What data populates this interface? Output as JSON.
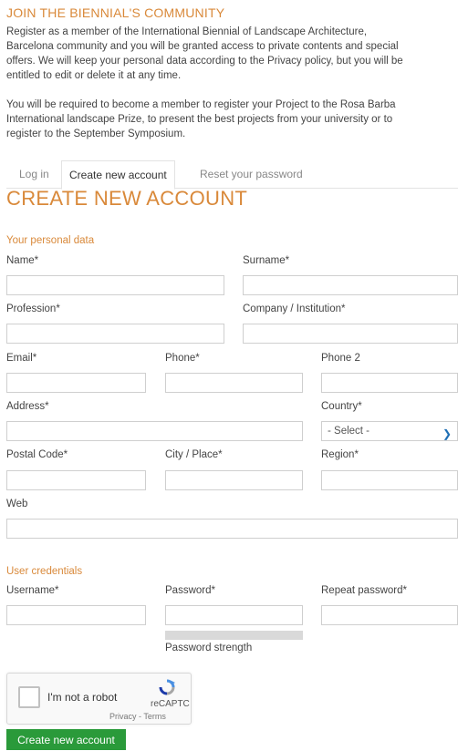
{
  "header": {
    "title": "JOIN THE BIENNIAL'S COMMUNITY",
    "para1": [
      "Register as a member of the International Biennial of Landscape Architecture,",
      "Barcelona community and you will be granted access to private contents and special",
      "offers. We will keep your personal data according to the Privacy policy, but you will be",
      "entitled to edit or delete it at any time."
    ],
    "para2": [
      "You will be required to become a member to register your Project to the Rosa Barba",
      "International landscape Prize, to present the best projects from your university or to",
      "register to the September Symposium."
    ]
  },
  "tabs": [
    {
      "label": "Log in",
      "active": false
    },
    {
      "label": "Create new account",
      "active": true
    },
    {
      "label": "Reset your password",
      "active": false
    }
  ],
  "form": {
    "title": "CREATE NEW ACCOUNT",
    "personal_section": "Your personal data",
    "labels": {
      "name": "Name*",
      "surname": "Surname*",
      "profession": "Profession*",
      "company": "Company / Institution*",
      "email": "Email*",
      "phone": "Phone*",
      "phone2": "Phone 2",
      "address": "Address*",
      "country": "Country*",
      "postal": "Postal Code*",
      "city": "City / Place*",
      "region": "Region*",
      "web": "Web"
    },
    "country_select": "- Select -",
    "credentials_section": "User credentials",
    "cred_labels": {
      "username": "Username*",
      "password": "Password*",
      "repeat": "Repeat password*"
    },
    "strength_label": "Password strength",
    "submit": "Create new account"
  },
  "captcha": {
    "label": "I'm not a robot",
    "brand": "reCAPTC",
    "links": "Privacy - Terms"
  },
  "colors": {
    "accent": "#d9893a",
    "button": "#2a9a3a",
    "chevron": "#1f6fb5"
  }
}
